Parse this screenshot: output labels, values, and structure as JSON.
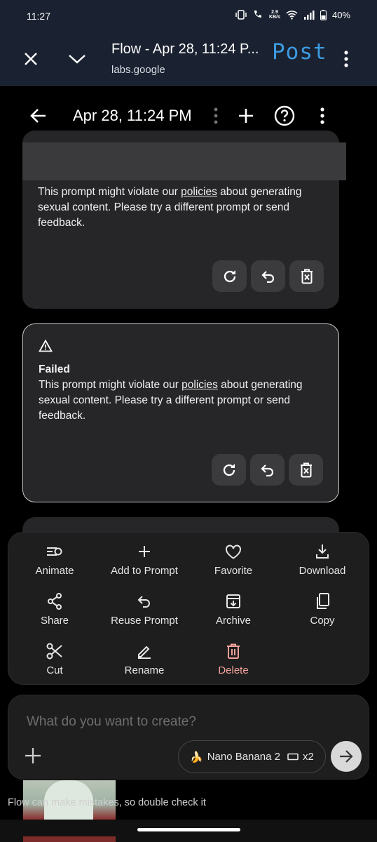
{
  "status": {
    "time": "11:27",
    "speed_top": "2.9",
    "speed_bottom": "KB/s",
    "battery": "40%"
  },
  "browser": {
    "title": "Flow - Apr 28, 11:24 P...",
    "domain": "labs.google",
    "post_label": "Post"
  },
  "header": {
    "date": "Apr 28, 11:24 PM"
  },
  "cards": [
    {
      "message_before": "This prompt might violate our ",
      "link": "policies",
      "message_after": " about generating sexual content. Please try a different prompt or send feedback."
    },
    {
      "status": "Failed",
      "message_before": "This prompt might violate our ",
      "link": "policies",
      "message_after": " about generating sexual content. Please try a different prompt or send feedback."
    }
  ],
  "menu": {
    "animate": "Animate",
    "add_to_prompt": "Add to Prompt",
    "favorite": "Favorite",
    "download": "Download",
    "share": "Share",
    "reuse_prompt": "Reuse Prompt",
    "archive": "Archive",
    "copy": "Copy",
    "cut": "Cut",
    "rename": "Rename",
    "delete": "Delete"
  },
  "prompt": {
    "placeholder": "What do you want to create?",
    "model_emoji": "🍌",
    "model": "Nano Banana 2",
    "count": "x2"
  },
  "disclaimer": "Flow can make mistakes, so double check it",
  "colors": {
    "accent_post": "#3d9be0",
    "danger": "#f4a29b",
    "card_bg": "#262628"
  }
}
